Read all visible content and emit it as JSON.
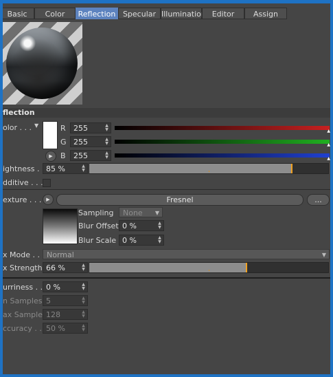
{
  "tabs": [
    {
      "label": "Basic"
    },
    {
      "label": "Color"
    },
    {
      "label": "Reflection"
    },
    {
      "label": "Specular"
    },
    {
      "label": "Illumination"
    },
    {
      "label": "Editor"
    },
    {
      "label": "Assign"
    }
  ],
  "active_tab": "Reflection",
  "section_title": "flection",
  "color": {
    "label": "olor . . .",
    "swatch": "#ffffff",
    "r_label": "R",
    "r_value": "255",
    "g_label": "G",
    "g_value": "255",
    "b_label": "B",
    "b_value": "255",
    "r_color": "#c82020",
    "g_color": "#20b020",
    "b_color": "#2040d0"
  },
  "brightness": {
    "label": "ightness . . .",
    "value": "85 %",
    "level": 0.85
  },
  "additive": {
    "label": "dditive . . ."
  },
  "texture": {
    "label": "exture . . . .",
    "shader_label": "Fresnel",
    "more_label": "...",
    "sampling_label": "Sampling",
    "sampling_value": "None",
    "blur_offset_label": "Blur Offset",
    "blur_offset_value": "0 %",
    "blur_scale_label": "Blur Scale",
    "blur_scale_value": "0 %"
  },
  "mix_mode": {
    "label": "x Mode . . .",
    "value": "Normal"
  },
  "mix_strength": {
    "label": "x Strength",
    "value": "66 %",
    "level": 0.66
  },
  "blurriness": {
    "label": "urriness . . .",
    "value": "0 %"
  },
  "min_samples": {
    "label": "n Samples",
    "value": "5"
  },
  "max_samples": {
    "label": "ax Samples",
    "value": "128"
  },
  "accuracy": {
    "label": "ccuracy . . .",
    "value": "50 %"
  }
}
